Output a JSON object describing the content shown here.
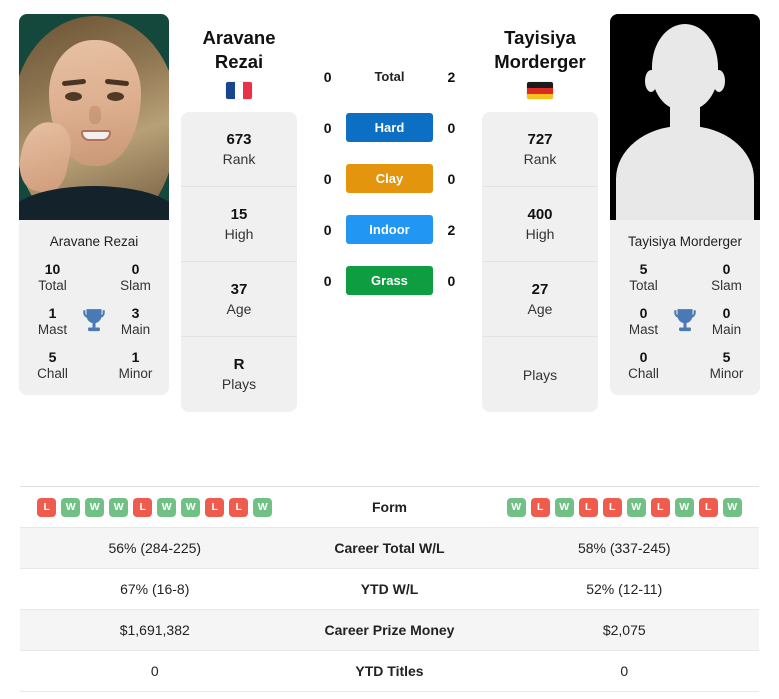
{
  "players": {
    "left": {
      "name": "Aravane Rezai",
      "name_line1": "Aravane",
      "name_line2": "Rezai",
      "country": "France",
      "flag": "fr-flag",
      "photo_caption": "Aravane Rezai",
      "titles": {
        "total_value": "10",
        "total_label": "Total",
        "slam_value": "0",
        "slam_label": "Slam",
        "mast_value": "1",
        "mast_label": "Mast",
        "main_value": "3",
        "main_label": "Main",
        "chall_value": "5",
        "chall_label": "Chall",
        "minor_value": "1",
        "minor_label": "Minor"
      },
      "stack": [
        {
          "value": "673",
          "label": "Rank"
        },
        {
          "value": "15",
          "label": "High"
        },
        {
          "value": "37",
          "label": "Age"
        },
        {
          "value": "R",
          "label": "Plays"
        }
      ],
      "form": [
        "L",
        "W",
        "W",
        "W",
        "L",
        "W",
        "W",
        "L",
        "L",
        "W"
      ],
      "career_total_wl": "56% (284-225)",
      "ytd_wl": "67% (16-8)",
      "career_prize_money": "$1,691,382",
      "ytd_titles": "0"
    },
    "right": {
      "name": "Tayisiya Morderger",
      "name_line1": "Tayisiya",
      "name_line2": "Morderger",
      "country": "Germany",
      "flag": "de-flag",
      "photo_caption": "Tayisiya Morderger",
      "titles": {
        "total_value": "5",
        "total_label": "Total",
        "slam_value": "0",
        "slam_label": "Slam",
        "mast_value": "0",
        "mast_label": "Mast",
        "main_value": "0",
        "main_label": "Main",
        "chall_value": "0",
        "chall_label": "Chall",
        "minor_value": "5",
        "minor_label": "Minor"
      },
      "stack": [
        {
          "value": "727",
          "label": "Rank"
        },
        {
          "value": "400",
          "label": "High"
        },
        {
          "value": "27",
          "label": "Age"
        },
        {
          "value": "",
          "label": "Plays"
        }
      ],
      "form": [
        "W",
        "L",
        "W",
        "L",
        "L",
        "W",
        "L",
        "W",
        "L",
        "W"
      ],
      "career_total_wl": "58% (337-245)",
      "ytd_wl": "52% (12-11)",
      "career_prize_money": "$2,075",
      "ytd_titles": "0"
    }
  },
  "head_to_head": [
    {
      "label": "Total",
      "left": "0",
      "right": "2",
      "color": ""
    },
    {
      "label": "Hard",
      "left": "0",
      "right": "0",
      "color": "#0c6fc4"
    },
    {
      "label": "Clay",
      "left": "0",
      "right": "0",
      "color": "#e3950d"
    },
    {
      "label": "Indoor",
      "left": "0",
      "right": "2",
      "color": "#2196f3"
    },
    {
      "label": "Grass",
      "left": "0",
      "right": "0",
      "color": "#0f9d41"
    }
  ],
  "table": {
    "rows": [
      {
        "label": "Form"
      },
      {
        "label": "Career Total W/L"
      },
      {
        "label": "YTD W/L"
      },
      {
        "label": "Career Prize Money"
      },
      {
        "label": "YTD Titles"
      }
    ]
  },
  "colors": {
    "win": "#71c086",
    "loss": "#ef5b4c",
    "trophy": "#4a7ab5",
    "panel": "#f0f0f0"
  }
}
